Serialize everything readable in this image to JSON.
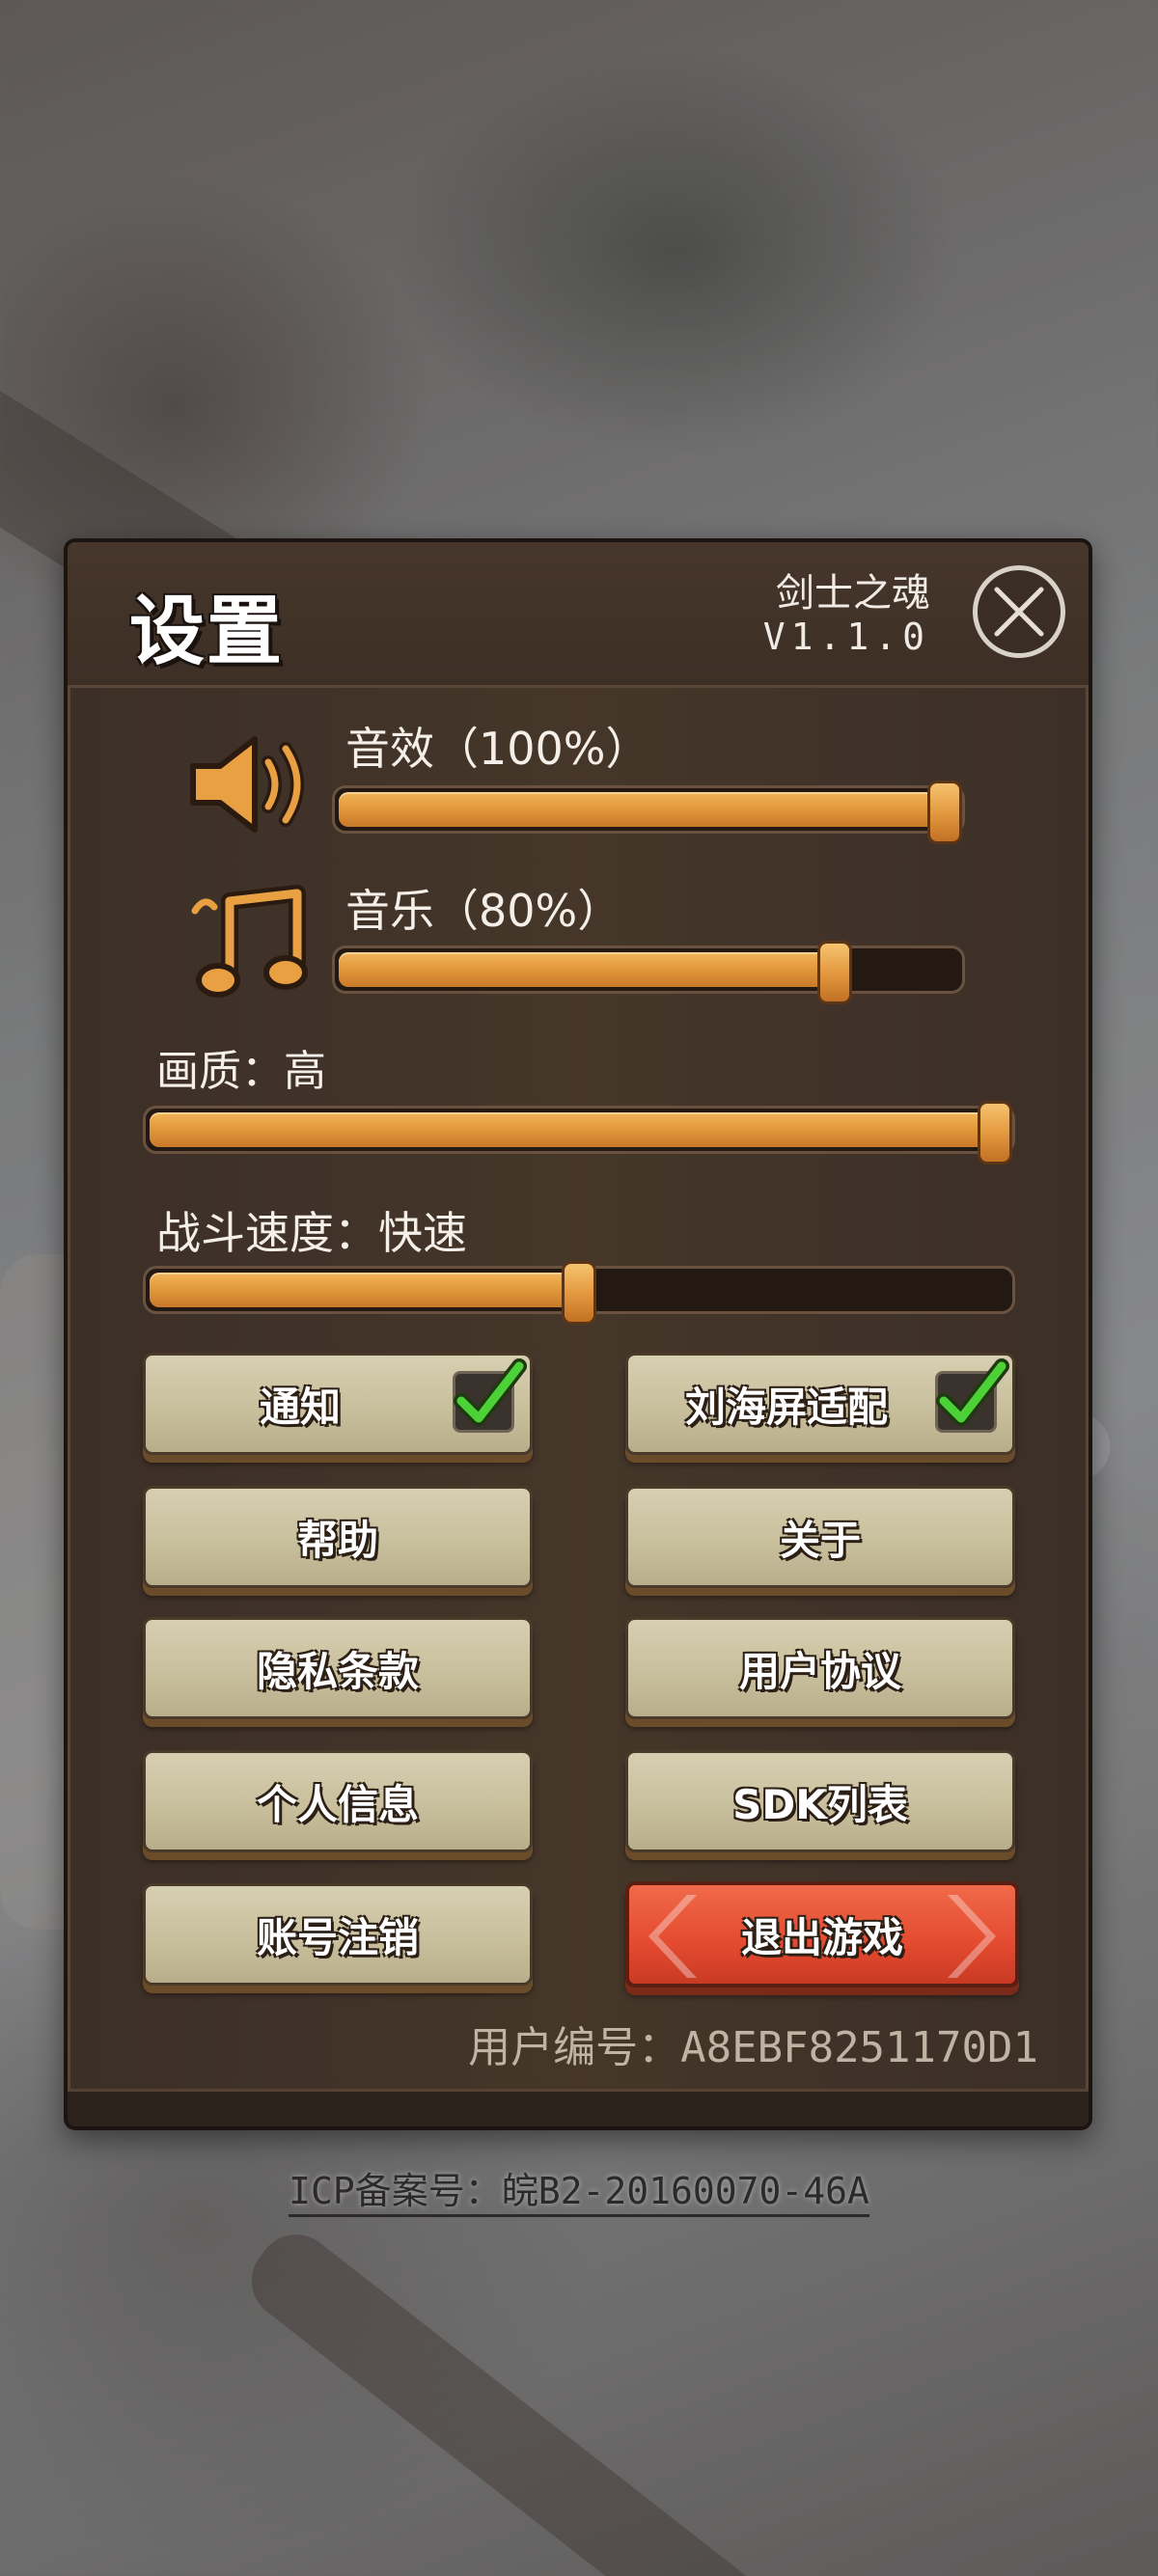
{
  "header": {
    "title": "设置",
    "game_name": "剑士之魂",
    "version": "V1.1.0"
  },
  "sliders": {
    "sound_effects": {
      "label": "音效（100%）",
      "value": 1.0,
      "icon": "speaker-icon"
    },
    "music": {
      "label": "音乐（80%）",
      "value": 0.8,
      "icon": "music-note-icon"
    },
    "graphics_quality": {
      "label": "画质：高",
      "value": 1.0
    },
    "battle_speed": {
      "label": "战斗速度：快速",
      "value": 0.5
    }
  },
  "buttons": {
    "notification": {
      "label": "通知",
      "checked": true
    },
    "notch_adapt": {
      "label": "刘海屏适配",
      "checked": true
    },
    "help": "帮助",
    "about": "关于",
    "privacy": "隐私条款",
    "user_agreement": "用户协议",
    "personal_info": "个人信息",
    "sdk_list": "SDK列表",
    "account_cancel": "账号注销",
    "exit_game": "退出游戏"
  },
  "user_id": "用户编号：A8EBF8251170D1",
  "icp": "ICP备案号：皖B2-20160070-46A",
  "colors": {
    "panel": "#3f3127",
    "slider_fill": "#e39a3c",
    "button": "#c8bf9d",
    "exit_button": "#e44a30",
    "check": "#4cd137"
  }
}
